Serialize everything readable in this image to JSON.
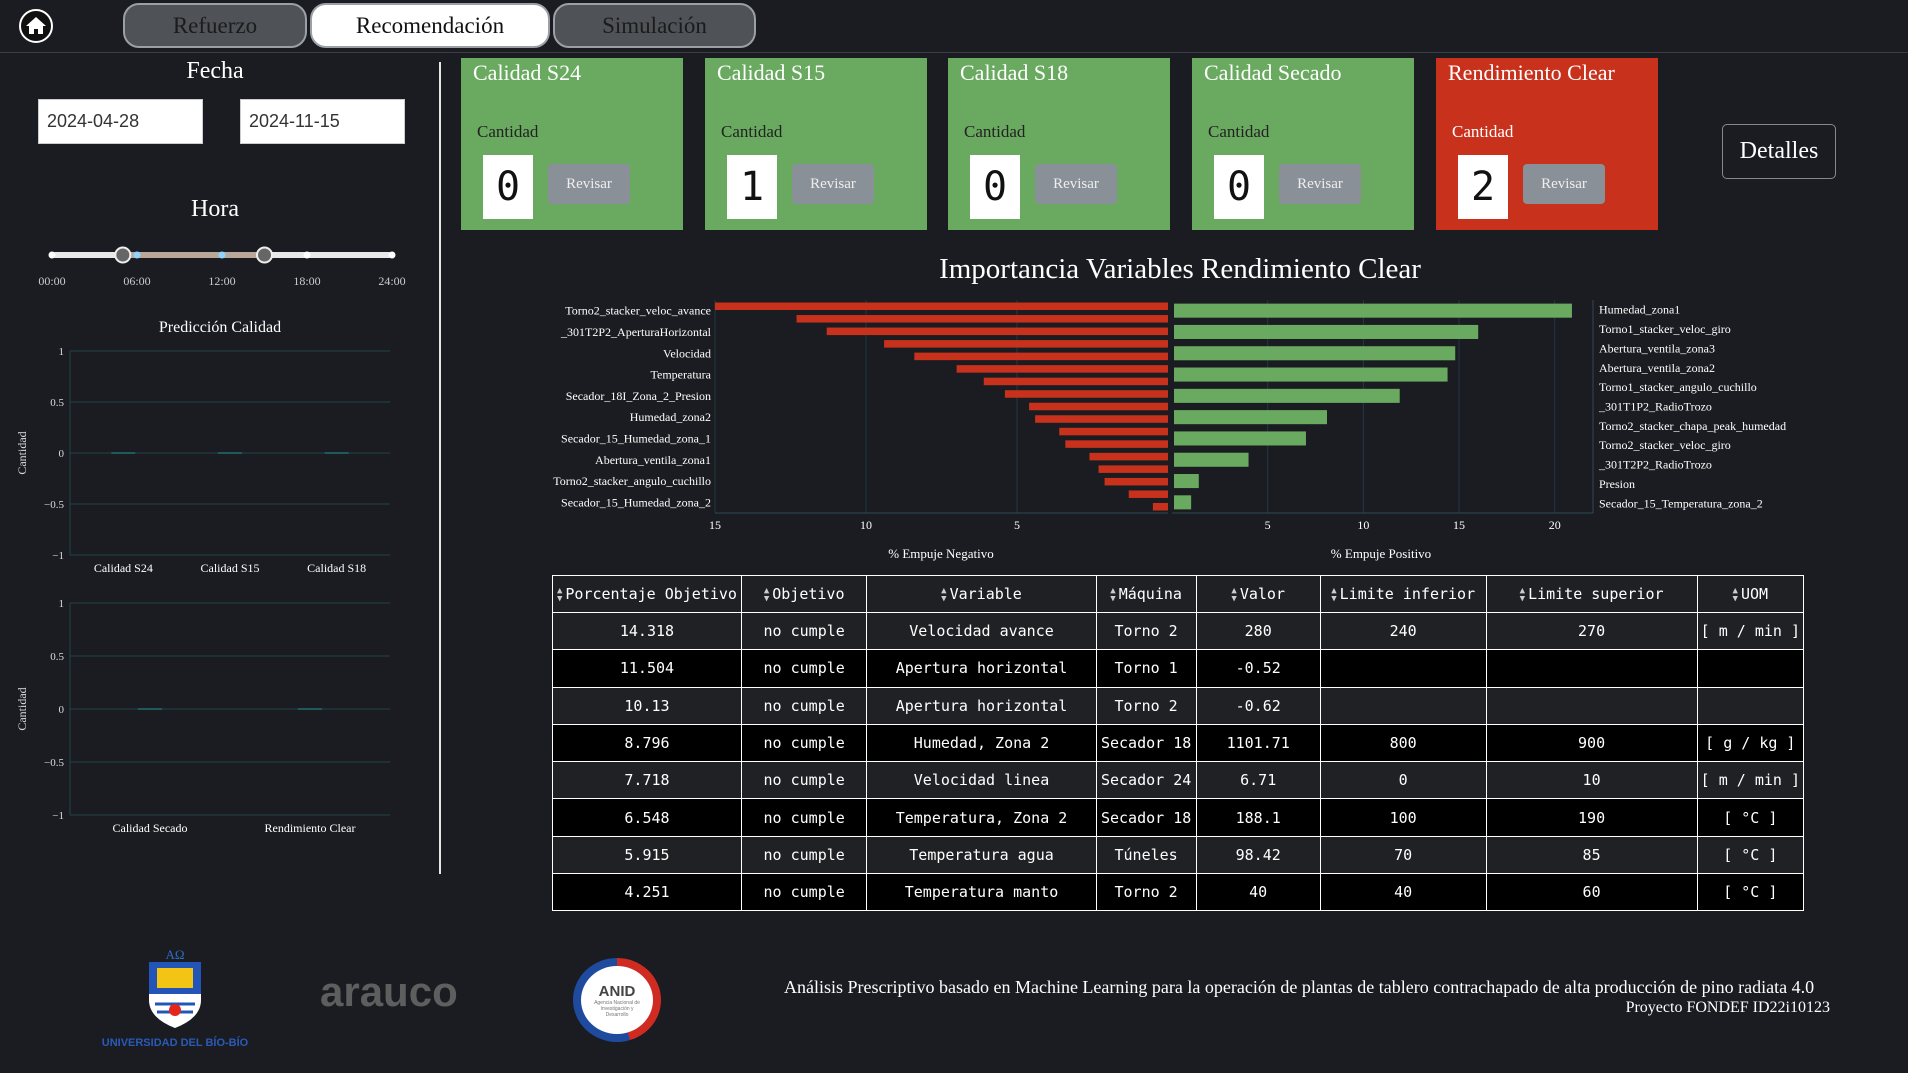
{
  "nav": {
    "tabs": [
      {
        "label": "Refuerzo",
        "active": false
      },
      {
        "label": "Recomendación",
        "active": true
      },
      {
        "label": "Simulación",
        "active": false
      }
    ]
  },
  "filters": {
    "date_title": "Fecha",
    "start_date": "2024-04-28",
    "end_date": "2024-11-15",
    "hour_title": "Hora",
    "hour_ticks": [
      "00:00",
      "06:00",
      "12:00",
      "18:00",
      "24:00"
    ],
    "hour_range": [
      5,
      15
    ]
  },
  "prediction": {
    "title": "Predicción Calidad",
    "ylabel": "Cantidad"
  },
  "cards": [
    {
      "title": "Calidad S24",
      "sub": "Cantidad",
      "count": "0",
      "button": "Revisar",
      "status": "ok"
    },
    {
      "title": "Calidad S15",
      "sub": "Cantidad",
      "count": "1",
      "button": "Revisar",
      "status": "ok"
    },
    {
      "title": "Calidad S18",
      "sub": "Cantidad",
      "count": "0",
      "button": "Revisar",
      "status": "ok"
    },
    {
      "title": "Calidad Secado",
      "sub": "Cantidad",
      "count": "0",
      "button": "Revisar",
      "status": "ok"
    },
    {
      "title": "Rendimiento Clear",
      "sub": "Cantidad",
      "count": "2",
      "button": "Revisar",
      "status": "alert"
    }
  ],
  "details_button": "Detalles",
  "colors": {
    "ok": "#6aaa60",
    "alert": "#c8321c",
    "neg_bar": "#c8321c",
    "pos_bar": "#6aaa60"
  },
  "chart_data": [
    {
      "type": "bar",
      "categories": [
        "Calidad S24",
        "Calidad S15",
        "Calidad S18"
      ],
      "ylim": [
        -1,
        1
      ],
      "yticks": [
        "1",
        "0.5",
        "0",
        "−0.5",
        "−1"
      ],
      "ylabel": "Cantidad",
      "title": "Predicción Calidad"
    },
    {
      "type": "bar",
      "categories": [
        "Calidad Secado",
        "Rendimiento Clear"
      ],
      "ylim": [
        -1,
        1
      ],
      "yticks": [
        "1",
        "0.5",
        "0",
        "−0.5",
        "−1"
      ],
      "ylabel": "Cantidad"
    },
    {
      "type": "bar",
      "title": "Importancia Variables Rendimiento Clear",
      "negative": {
        "xlabel": "% Empuje Negativo",
        "xticks": [
          15,
          10,
          5
        ],
        "xlim": [
          15,
          0
        ],
        "categories": [
          "Torno2_stacker_veloc_avance",
          "_301T2P2_AperturaHorizontal",
          "Velocidad",
          "Temperatura",
          "Secador_18I_Zona_2_Presion",
          "Humedad_zona2",
          "Secador_15_Humedad_zona_1",
          "Abertura_ventila_zona1",
          "Torno2_stacker_angulo_cuchillo",
          "Secador_15_Humedad_zona_2"
        ],
        "values": [
          15.0,
          12.3,
          11.3,
          9.4,
          8.4,
          7.0,
          6.1,
          5.4,
          4.6,
          4.4,
          3.6,
          3.4,
          2.6,
          2.3,
          2.1,
          1.3,
          0.5
        ]
      },
      "positive": {
        "xlabel": "% Empuje Positivo",
        "xticks": [
          5,
          10,
          15,
          20
        ],
        "xlim": [
          0,
          22
        ],
        "categories": [
          "Humedad_zona1",
          "Torno1_stacker_veloc_giro",
          "Abertura_ventila_zona3",
          "Abertura_ventila_zona2",
          "Torno1_stacker_angulo_cuchillo",
          "_301T1P2_RadioTrozo",
          "Torno2_stacker_chapa_peak_humedad",
          "Torno2_stacker_veloc_giro",
          "_301T2P2_RadioTrozo",
          "Presion",
          "Secador_15_Temperatura_zona_2"
        ],
        "values": [
          20.9,
          16.0,
          14.8,
          14.4,
          11.9,
          8.1,
          7.0,
          4.0,
          1.4,
          1.0
        ]
      }
    }
  ],
  "table": {
    "headers": [
      "Porcentaje Objetivo",
      "Objetivo",
      "Variable",
      "Máquina",
      "Valor",
      "Limite inferior",
      "Limite superior",
      "UOM"
    ],
    "rows": [
      [
        "14.318",
        "no cumple",
        "Velocidad avance",
        "Torno 2",
        "280",
        "240",
        "270",
        "[ m / min ]"
      ],
      [
        "11.504",
        "no cumple",
        "Apertura horizontal",
        "Torno 1",
        "-0.52",
        "",
        "",
        ""
      ],
      [
        "10.13",
        "no cumple",
        "Apertura horizontal",
        "Torno 2",
        "-0.62",
        "",
        "",
        ""
      ],
      [
        "8.796",
        "no cumple",
        "Humedad, Zona 2",
        "Secador 18",
        "1101.71",
        "800",
        "900",
        "[ g / kg ]"
      ],
      [
        "7.718",
        "no cumple",
        "Velocidad linea",
        "Secador 24",
        "6.71",
        "0",
        "10",
        "[ m / min ]"
      ],
      [
        "6.548",
        "no cumple",
        "Temperatura, Zona 2",
        "Secador 18",
        "188.1",
        "100",
        "190",
        "[ °C ]"
      ],
      [
        "5.915",
        "no cumple",
        "Temperatura agua",
        "Túneles",
        "98.42",
        "70",
        "85",
        "[ °C ]"
      ],
      [
        "4.251",
        "no cumple",
        "Temperatura manto",
        "Torno 2",
        "40",
        "40",
        "60",
        "[ °C ]"
      ]
    ]
  },
  "footer": {
    "udb_name": "UNIVERSIDAD DEL BÍO-BÍO",
    "arauco": "arauco",
    "anid": "ANID",
    "anid_sub": "Agencia Nacional de Investigación y Desarrollo",
    "description": "Análisis Prescriptivo basado en Machine Learning para la operación de plantas de tablero contrachapado de alta producción de pino radiata 4.0",
    "project": "Proyecto FONDEF ID22i10123"
  }
}
